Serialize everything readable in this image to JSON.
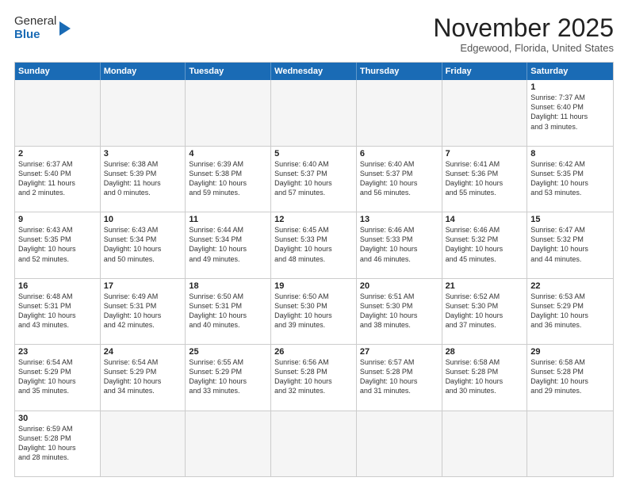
{
  "header": {
    "logo_line1": "General",
    "logo_line2": "Blue",
    "month": "November 2025",
    "location": "Edgewood, Florida, United States"
  },
  "days_of_week": [
    "Sunday",
    "Monday",
    "Tuesday",
    "Wednesday",
    "Thursday",
    "Friday",
    "Saturday"
  ],
  "rows": [
    [
      {
        "day": "",
        "text": "",
        "empty": true
      },
      {
        "day": "",
        "text": "",
        "empty": true
      },
      {
        "day": "",
        "text": "",
        "empty": true
      },
      {
        "day": "",
        "text": "",
        "empty": true
      },
      {
        "day": "",
        "text": "",
        "empty": true
      },
      {
        "day": "",
        "text": "",
        "empty": true
      },
      {
        "day": "1",
        "text": "Sunrise: 7:37 AM\nSunset: 6:40 PM\nDaylight: 11 hours\nand 3 minutes.",
        "empty": false
      }
    ],
    [
      {
        "day": "2",
        "text": "Sunrise: 6:37 AM\nSunset: 5:40 PM\nDaylight: 11 hours\nand 2 minutes.",
        "empty": false
      },
      {
        "day": "3",
        "text": "Sunrise: 6:38 AM\nSunset: 5:39 PM\nDaylight: 11 hours\nand 0 minutes.",
        "empty": false
      },
      {
        "day": "4",
        "text": "Sunrise: 6:39 AM\nSunset: 5:38 PM\nDaylight: 10 hours\nand 59 minutes.",
        "empty": false
      },
      {
        "day": "5",
        "text": "Sunrise: 6:40 AM\nSunset: 5:37 PM\nDaylight: 10 hours\nand 57 minutes.",
        "empty": false
      },
      {
        "day": "6",
        "text": "Sunrise: 6:40 AM\nSunset: 5:37 PM\nDaylight: 10 hours\nand 56 minutes.",
        "empty": false
      },
      {
        "day": "7",
        "text": "Sunrise: 6:41 AM\nSunset: 5:36 PM\nDaylight: 10 hours\nand 55 minutes.",
        "empty": false
      },
      {
        "day": "8",
        "text": "Sunrise: 6:42 AM\nSunset: 5:35 PM\nDaylight: 10 hours\nand 53 minutes.",
        "empty": false
      }
    ],
    [
      {
        "day": "9",
        "text": "Sunrise: 6:43 AM\nSunset: 5:35 PM\nDaylight: 10 hours\nand 52 minutes.",
        "empty": false
      },
      {
        "day": "10",
        "text": "Sunrise: 6:43 AM\nSunset: 5:34 PM\nDaylight: 10 hours\nand 50 minutes.",
        "empty": false
      },
      {
        "day": "11",
        "text": "Sunrise: 6:44 AM\nSunset: 5:34 PM\nDaylight: 10 hours\nand 49 minutes.",
        "empty": false
      },
      {
        "day": "12",
        "text": "Sunrise: 6:45 AM\nSunset: 5:33 PM\nDaylight: 10 hours\nand 48 minutes.",
        "empty": false
      },
      {
        "day": "13",
        "text": "Sunrise: 6:46 AM\nSunset: 5:33 PM\nDaylight: 10 hours\nand 46 minutes.",
        "empty": false
      },
      {
        "day": "14",
        "text": "Sunrise: 6:46 AM\nSunset: 5:32 PM\nDaylight: 10 hours\nand 45 minutes.",
        "empty": false
      },
      {
        "day": "15",
        "text": "Sunrise: 6:47 AM\nSunset: 5:32 PM\nDaylight: 10 hours\nand 44 minutes.",
        "empty": false
      }
    ],
    [
      {
        "day": "16",
        "text": "Sunrise: 6:48 AM\nSunset: 5:31 PM\nDaylight: 10 hours\nand 43 minutes.",
        "empty": false
      },
      {
        "day": "17",
        "text": "Sunrise: 6:49 AM\nSunset: 5:31 PM\nDaylight: 10 hours\nand 42 minutes.",
        "empty": false
      },
      {
        "day": "18",
        "text": "Sunrise: 6:50 AM\nSunset: 5:31 PM\nDaylight: 10 hours\nand 40 minutes.",
        "empty": false
      },
      {
        "day": "19",
        "text": "Sunrise: 6:50 AM\nSunset: 5:30 PM\nDaylight: 10 hours\nand 39 minutes.",
        "empty": false
      },
      {
        "day": "20",
        "text": "Sunrise: 6:51 AM\nSunset: 5:30 PM\nDaylight: 10 hours\nand 38 minutes.",
        "empty": false
      },
      {
        "day": "21",
        "text": "Sunrise: 6:52 AM\nSunset: 5:30 PM\nDaylight: 10 hours\nand 37 minutes.",
        "empty": false
      },
      {
        "day": "22",
        "text": "Sunrise: 6:53 AM\nSunset: 5:29 PM\nDaylight: 10 hours\nand 36 minutes.",
        "empty": false
      }
    ],
    [
      {
        "day": "23",
        "text": "Sunrise: 6:54 AM\nSunset: 5:29 PM\nDaylight: 10 hours\nand 35 minutes.",
        "empty": false
      },
      {
        "day": "24",
        "text": "Sunrise: 6:54 AM\nSunset: 5:29 PM\nDaylight: 10 hours\nand 34 minutes.",
        "empty": false
      },
      {
        "day": "25",
        "text": "Sunrise: 6:55 AM\nSunset: 5:29 PM\nDaylight: 10 hours\nand 33 minutes.",
        "empty": false
      },
      {
        "day": "26",
        "text": "Sunrise: 6:56 AM\nSunset: 5:28 PM\nDaylight: 10 hours\nand 32 minutes.",
        "empty": false
      },
      {
        "day": "27",
        "text": "Sunrise: 6:57 AM\nSunset: 5:28 PM\nDaylight: 10 hours\nand 31 minutes.",
        "empty": false
      },
      {
        "day": "28",
        "text": "Sunrise: 6:58 AM\nSunset: 5:28 PM\nDaylight: 10 hours\nand 30 minutes.",
        "empty": false
      },
      {
        "day": "29",
        "text": "Sunrise: 6:58 AM\nSunset: 5:28 PM\nDaylight: 10 hours\nand 29 minutes.",
        "empty": false
      }
    ],
    [
      {
        "day": "30",
        "text": "Sunrise: 6:59 AM\nSunset: 5:28 PM\nDaylight: 10 hours\nand 28 minutes.",
        "empty": false
      },
      {
        "day": "",
        "text": "",
        "empty": true
      },
      {
        "day": "",
        "text": "",
        "empty": true
      },
      {
        "day": "",
        "text": "",
        "empty": true
      },
      {
        "day": "",
        "text": "",
        "empty": true
      },
      {
        "day": "",
        "text": "",
        "empty": true
      },
      {
        "day": "",
        "text": "",
        "empty": true
      }
    ]
  ]
}
